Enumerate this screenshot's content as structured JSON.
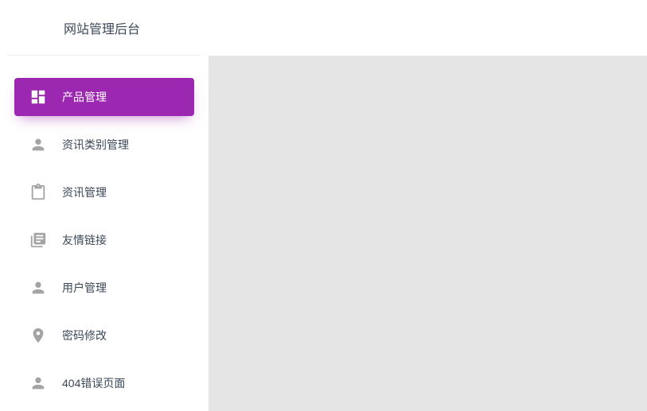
{
  "header": {
    "title": "网站管理后台"
  },
  "nav": {
    "items": [
      {
        "label": "产品管理",
        "icon": "dashboard",
        "active": true
      },
      {
        "label": "资讯类别管理",
        "icon": "person",
        "active": false
      },
      {
        "label": "资讯管理",
        "icon": "clipboard",
        "active": false
      },
      {
        "label": "友情链接",
        "icon": "library",
        "active": false
      },
      {
        "label": "用户管理",
        "icon": "person",
        "active": false
      },
      {
        "label": "密码修改",
        "icon": "location",
        "active": false
      },
      {
        "label": "404错误页面",
        "icon": "person",
        "active": false
      }
    ]
  }
}
